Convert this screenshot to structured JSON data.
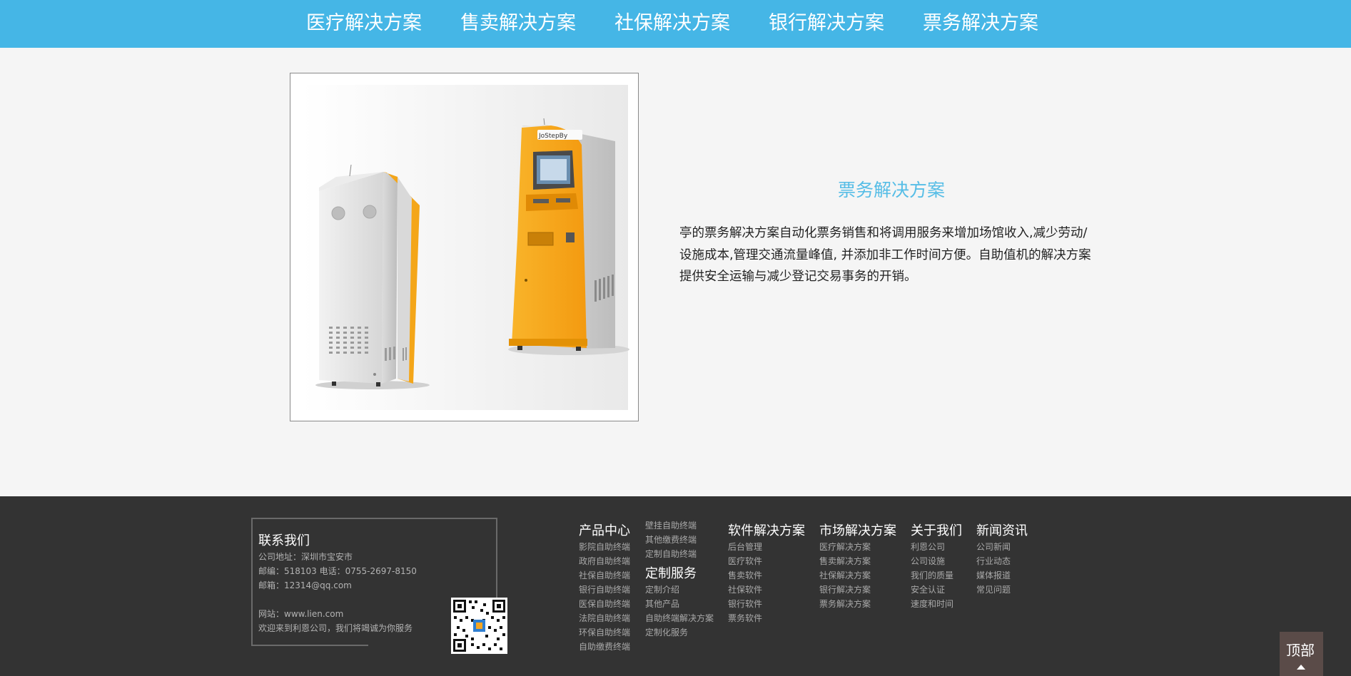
{
  "nav": {
    "items": [
      "医疗解决方案",
      "售卖解决方案",
      "社保解决方案",
      "银行解决方案",
      "票务解决方案"
    ]
  },
  "product": {
    "kiosk_brand_label": "JoStepBy"
  },
  "solution": {
    "title": "票务解决方案",
    "lines": [
      "亭的票务解决方案自动化票务销售和将调用服务来增加场馆收入,减少劳动/",
      "设施成本,管理交通流量峰值, 并添加非工作时间方便。自助值机的解决方案",
      "提供安全运输与减少登记交易事务的开销。"
    ]
  },
  "footer": {
    "contact": {
      "title": "联系我们",
      "address": "公司地址：深圳市宝安市",
      "postal_phone": "邮编：518103 电话：0755-2697-8150",
      "email": "邮箱：12314@qq.com",
      "website": "网站：www.lien.com",
      "welcome": "欢迎来到利恩公司，我们将竭诚为你服务"
    },
    "products": {
      "title": "产品中心",
      "items": [
        "影院自助终端",
        "政府自助终端",
        "社保自助终端",
        "银行自助终端",
        "医保自助终端",
        "法院自助终端",
        "环保自助终端",
        "自助缴费终端"
      ]
    },
    "products_extra": {
      "items": [
        "壁挂自助终端",
        "其他缴费终端",
        "定制自助终端"
      ]
    },
    "custom": {
      "title": "定制服务",
      "items": [
        "定制介绍",
        "其他产品",
        "自助终端解决方案",
        "定制化服务"
      ]
    },
    "software": {
      "title": "软件解决方案",
      "items": [
        "后台管理",
        "医疗软件",
        "售卖软件",
        "社保软件",
        "银行软件",
        "票务软件"
      ]
    },
    "market": {
      "title": "市场解决方案",
      "items": [
        "医疗解决方案",
        "售卖解决方案",
        "社保解决方案",
        "银行解决方案",
        "票务解决方案"
      ]
    },
    "about": {
      "title": "关于我们",
      "items": [
        "利恩公司",
        "公司设施",
        "我们的质量",
        "安全认证",
        "速度和时间"
      ]
    },
    "news": {
      "title": "新闻资讯",
      "items": [
        "公司新闻",
        "行业动态",
        "媒体报道",
        "常见问题"
      ]
    }
  },
  "back_to_top": {
    "label": "顶部"
  },
  "colors": {
    "nav_bg": "#45b6e6",
    "title_blue": "#56bde6",
    "footer_bg": "#333333",
    "kiosk_yellow": "#f7a61a"
  }
}
